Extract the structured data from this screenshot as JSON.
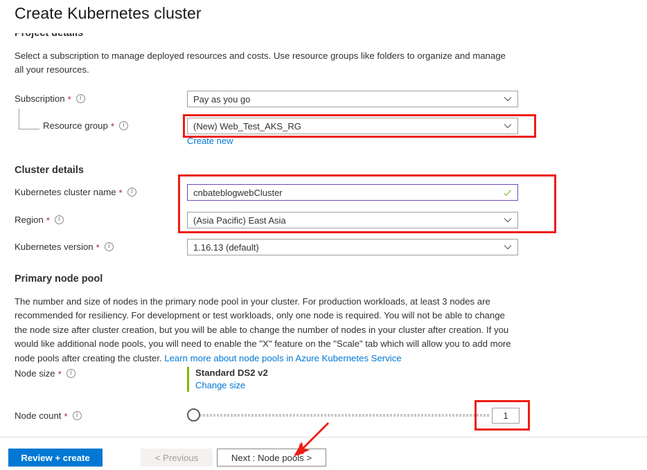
{
  "page": {
    "title": "Create Kubernetes cluster"
  },
  "project_details": {
    "heading": "Project details",
    "description": "Select a subscription to manage deployed resources and costs. Use resource groups like folders to organize and manage all your resources.",
    "subscription": {
      "label": "Subscription",
      "required_marker": "*",
      "info_icon": "info-icon",
      "value": "Pay as you go",
      "chevron": "chevron-down-icon"
    },
    "resource_group": {
      "label": "Resource group",
      "required_marker": "*",
      "info_icon": "info-icon",
      "value": "(New) Web_Test_AKS_RG",
      "chevron": "chevron-down-icon",
      "create_new_link": "Create new"
    }
  },
  "cluster_details": {
    "heading": "Cluster details",
    "cluster_name": {
      "label": "Kubernetes cluster name",
      "required_marker": "*",
      "info_icon": "info-icon",
      "value": "cnbateblogwebCluster",
      "validation_icon": "check-icon"
    },
    "region": {
      "label": "Region",
      "required_marker": "*",
      "info_icon": "info-icon",
      "value": "(Asia Pacific) East Asia",
      "chevron": "chevron-down-icon"
    },
    "kubernetes_version": {
      "label": "Kubernetes version",
      "required_marker": "*",
      "info_icon": "info-icon",
      "value": "1.16.13 (default)",
      "chevron": "chevron-down-icon"
    }
  },
  "primary_node_pool": {
    "heading": "Primary node pool",
    "description_part1": "The number and size of nodes in the primary node pool in your cluster. For production workloads, at least 3 nodes are recommended for resiliency. For development or test workloads, only one node is required. You will not be able to change the node size after cluster creation, but you will be able to change the number of nodes in your cluster after creation. If you would like additional node pools, you will need to enable the \"X\" feature on the \"Scale\" tab which will allow you to add more node pools after creating the cluster. ",
    "learn_more_link": "Learn more about node pools in Azure Kubernetes Service",
    "node_size": {
      "label": "Node size",
      "required_marker": "*",
      "info_icon": "info-icon",
      "value": "Standard DS2 v2",
      "change_link": "Change size"
    },
    "node_count": {
      "label": "Node count",
      "required_marker": "*",
      "info_icon": "info-icon",
      "value": "1",
      "slider_position_percent": 0
    }
  },
  "footer": {
    "review_create_label": "Review + create",
    "previous_label": "< Previous",
    "next_label": "Next : Node pools >"
  },
  "annotations": {
    "accent_red": "#ee1c14",
    "arrow_name": "red-pointer-arrow"
  }
}
